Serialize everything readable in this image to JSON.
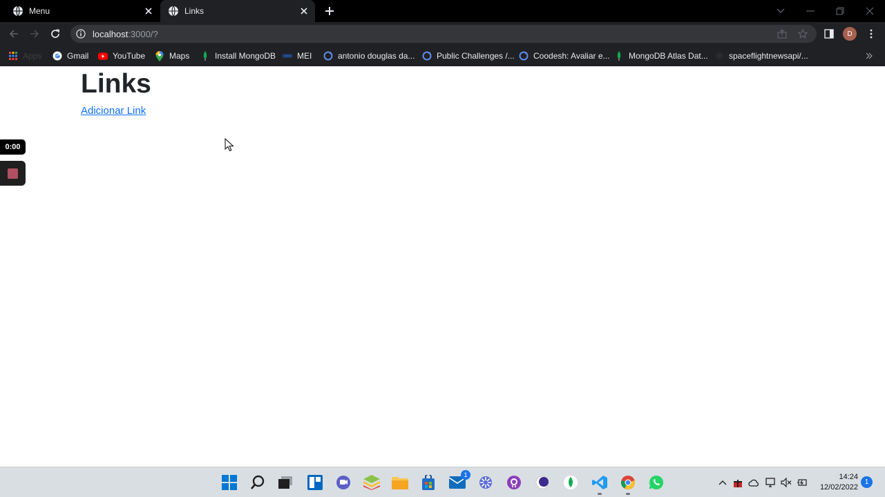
{
  "tabs": [
    {
      "title": "Menu",
      "active": false
    },
    {
      "title": "Links",
      "active": true
    }
  ],
  "address_bar": {
    "host": "localhost",
    "rest": ":3000/?"
  },
  "profile": {
    "initial": "D"
  },
  "bookmarks": [
    {
      "label": "Apps",
      "icon": "apps-grid-icon"
    },
    {
      "label": "Gmail",
      "icon": "google-icon"
    },
    {
      "label": "YouTube",
      "icon": "youtube-icon"
    },
    {
      "label": "Maps",
      "icon": "maps-pin-icon"
    },
    {
      "label": "Install MongoDB",
      "icon": "mongodb-leaf-icon"
    },
    {
      "label": "MEI",
      "icon": "mei-icon"
    },
    {
      "label": "antonio douglas da...",
      "icon": "globe-ring-icon"
    },
    {
      "label": "Public Challenges /...",
      "icon": "globe-ring-icon"
    },
    {
      "label": "Coodesh: Avaliar e...",
      "icon": "globe-ring-icon"
    },
    {
      "label": "MongoDB Atlas Dat...",
      "icon": "mongodb-leaf-icon"
    },
    {
      "label": "spaceflightnewsapi/...",
      "icon": "blank-page-icon"
    }
  ],
  "page": {
    "heading": "Links",
    "add_link": "Adicionar Link"
  },
  "recorder": {
    "timer": "0:00"
  },
  "taskbar": {
    "mail_badge": "1",
    "time": "14:24",
    "date": "12/02/2022",
    "notifications": "1"
  },
  "colors": {
    "chrome_dark": "#202124",
    "tabstrip": "#000000",
    "link_blue": "#0d6efd",
    "heading": "#212529"
  }
}
